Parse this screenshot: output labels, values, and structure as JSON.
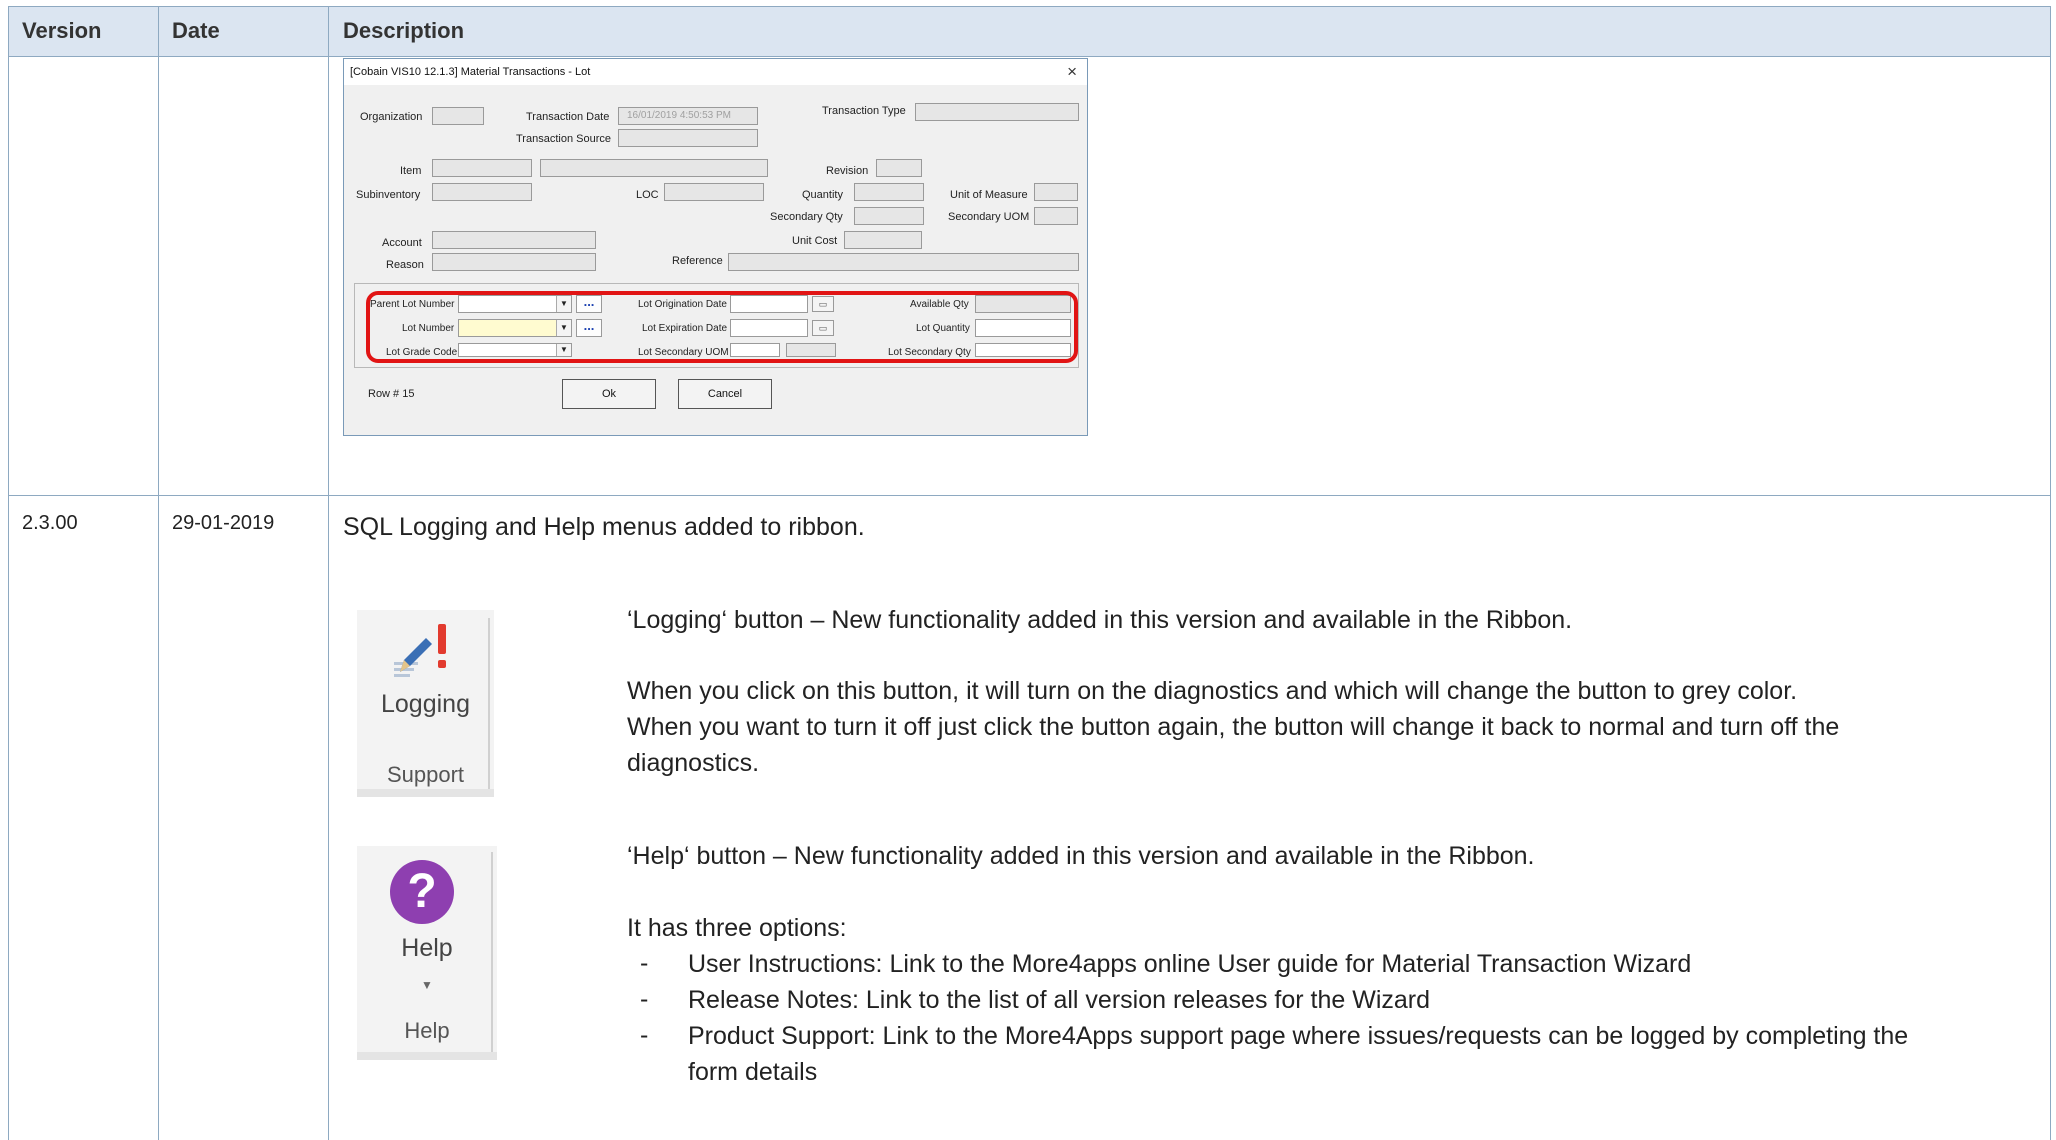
{
  "table": {
    "headers": {
      "version": "Version",
      "date": "Date",
      "description": "Description"
    }
  },
  "dialog": {
    "title": "[Cobain VIS10 12.1.3] Material Transactions - Lot",
    "close_symbol": "×",
    "labels": {
      "organization": "Organization",
      "transaction_date": "Transaction Date",
      "transaction_type": "Transaction Type",
      "transaction_source": "Transaction Source",
      "item": "Item",
      "revision": "Revision",
      "subinventory": "Subinventory",
      "loc": "LOC",
      "quantity": "Quantity",
      "unit_of_measure": "Unit of Measure",
      "secondary_qty": "Secondary Qty",
      "secondary_uom": "Secondary UOM",
      "account": "Account",
      "unit_cost": "Unit Cost",
      "reason": "Reason",
      "reference": "Reference",
      "parent_lot_number": "Parent Lot Number",
      "lot_origination_date": "Lot Origination Date",
      "available_qty": "Available Qty",
      "lot_number": "Lot Number",
      "lot_expiration_date": "Lot Expiration Date",
      "lot_quantity": "Lot Quantity",
      "lot_grade_code": "Lot Grade Code",
      "lot_secondary_uom": "Lot Secondary UOM",
      "lot_secondary_qty": "Lot Secondary Qty",
      "row": "Row # 15"
    },
    "values": {
      "transaction_date": "16/01/2019 4:50:53 PM"
    },
    "buttons": {
      "ok": "Ok",
      "cancel": "Cancel"
    },
    "dots": "...",
    "dropdown_arrow": "▼"
  },
  "row2": {
    "version": "2.3.00",
    "date": "29-01-2019",
    "summary": "SQL Logging and Help menus added to ribbon.",
    "logging": {
      "button_label": "Logging",
      "group_label": "Support",
      "heading": "‘Logging‘ button – New functionality added in this version and available in the Ribbon.",
      "line1": "When you click on this button, it will turn on the diagnostics and which will change the button to grey color.",
      "line2": "When you want to turn it off just click the button again, the button will change it back to normal and turn off the",
      "line3": "diagnostics."
    },
    "help": {
      "button_label": "Help",
      "group_label": "Help",
      "icon_glyph": "?",
      "heading": "‘Help‘ button – New functionality added in this version and available in the Ribbon.",
      "intro": "It has three options:",
      "options": [
        "User Instructions:  Link to the More4apps online User guide for Material Transaction Wizard",
        "Release Notes:  Link to the list of all version releases for the Wizard",
        "Product Support:  Link to the More4Apps support page where issues/requests can be logged by completing the"
      ],
      "option3_cont": "form details",
      "dash": "-"
    }
  },
  "colors": {
    "header_bg": "#dbe5f1",
    "grid": "#8ea9c1",
    "red_highlight": "#e11414",
    "help_purple": "#8e3fb0"
  }
}
